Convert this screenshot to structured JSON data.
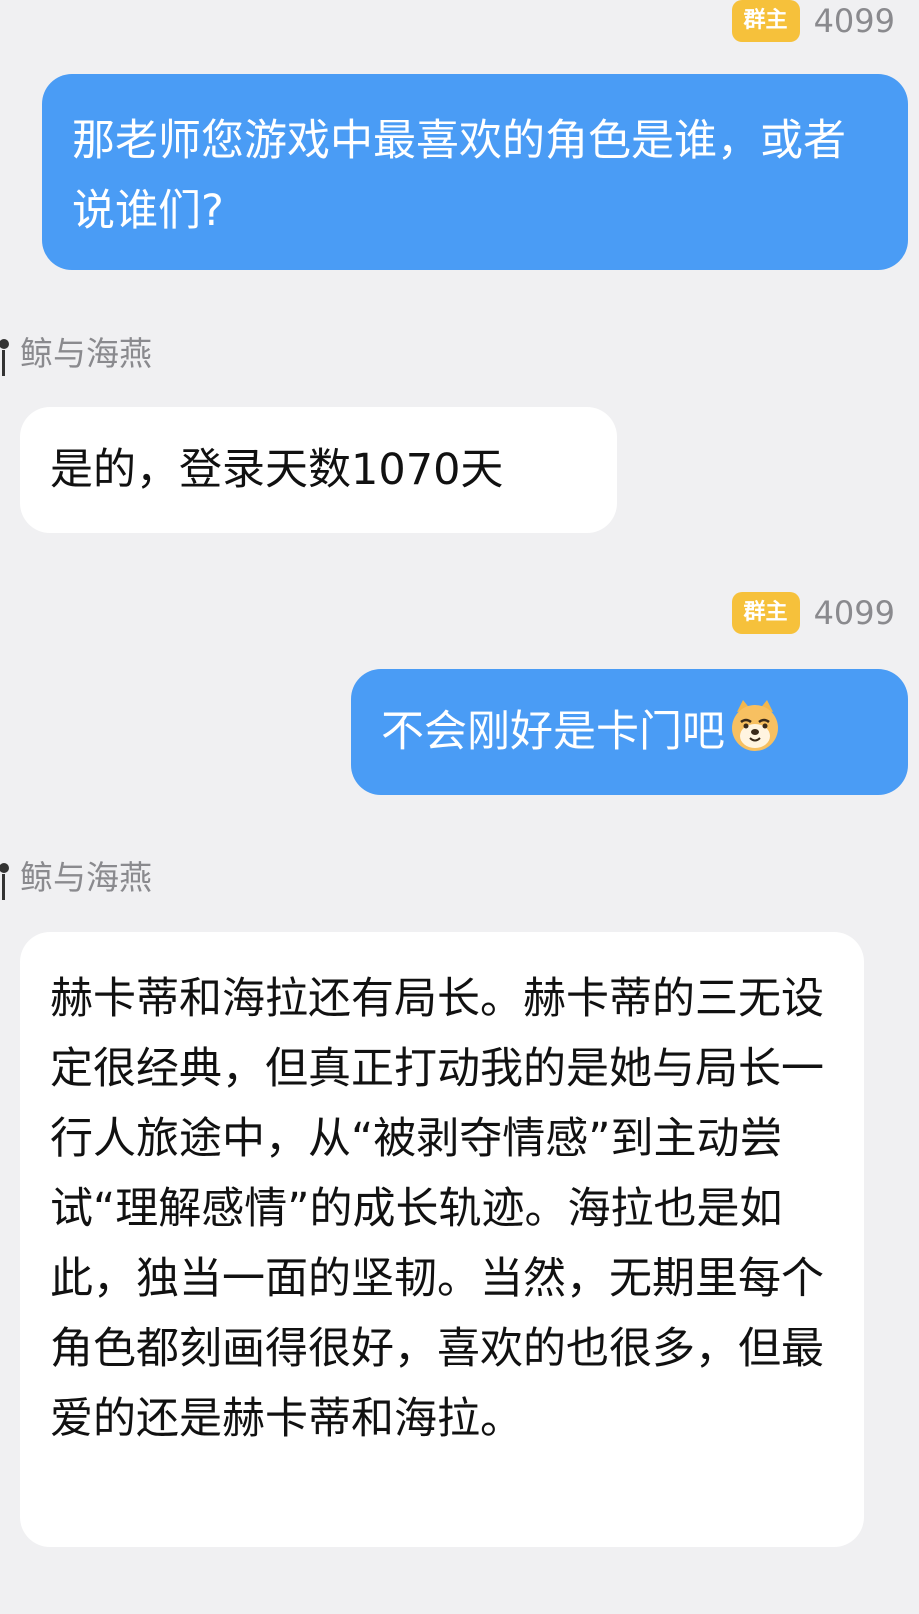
{
  "messages": [
    {
      "direction": "out",
      "role_badge": "群主",
      "nickname": "4099",
      "text": "那老师您游戏中最喜欢的角色是谁，或者说谁们?"
    },
    {
      "direction": "in",
      "sender": "鲸与海燕",
      "text": "是的，登录天数1070天"
    },
    {
      "direction": "out",
      "role_badge": "群主",
      "nickname": "4099",
      "text": "不会刚好是卡门吧",
      "emoji": "dog-sticker-emoji"
    },
    {
      "direction": "in",
      "sender": "鲸与海燕",
      "text": "赫卡蒂和海拉还有局长。赫卡蒂的三无设定很经典，但真正打动我的是她与局长一行人旅途中，从“被剥夺情感”到主动尝试“理解感情”的成长轨迹。海拉也是如此，独当一面的坚韧。当然，无期里每个角色都刻画得很好，喜欢的也很多，但最爱的还是赫卡蒂和海拉。"
    }
  ],
  "colors": {
    "background": "#f0f0f2",
    "outgoing_bubble": "#4a9cf5",
    "incoming_bubble": "#ffffff",
    "owner_badge": "#f6c13b",
    "meta_text": "#8a8a8e"
  }
}
